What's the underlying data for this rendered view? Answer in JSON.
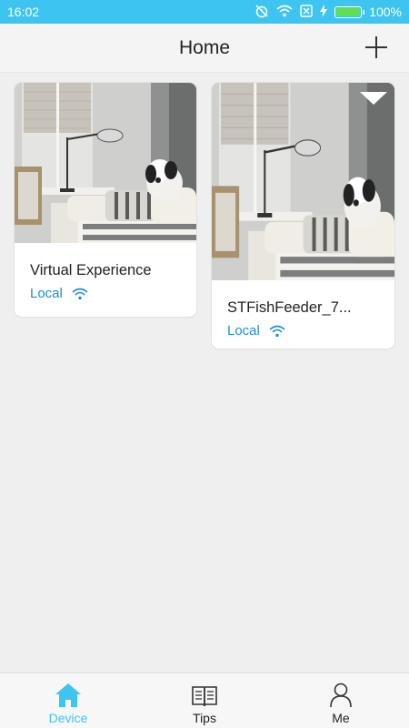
{
  "status_bar": {
    "time": "16:02",
    "battery_percent": "100%",
    "battery_level": 1.0
  },
  "header": {
    "title": "Home"
  },
  "devices": [
    {
      "name": "Virtual Experience",
      "status": "Local"
    },
    {
      "name": "STFishFeeder_7...",
      "status": "Local"
    }
  ],
  "bottom_nav": [
    {
      "label": "Device",
      "icon": "home-icon",
      "active": true
    },
    {
      "label": "Tips",
      "icon": "book-icon",
      "active": false
    },
    {
      "label": "Me",
      "icon": "person-icon",
      "active": false
    }
  ],
  "colors": {
    "accent": "#3ec4f0",
    "local_blue": "#1e8fd5",
    "background": "#efefef"
  }
}
